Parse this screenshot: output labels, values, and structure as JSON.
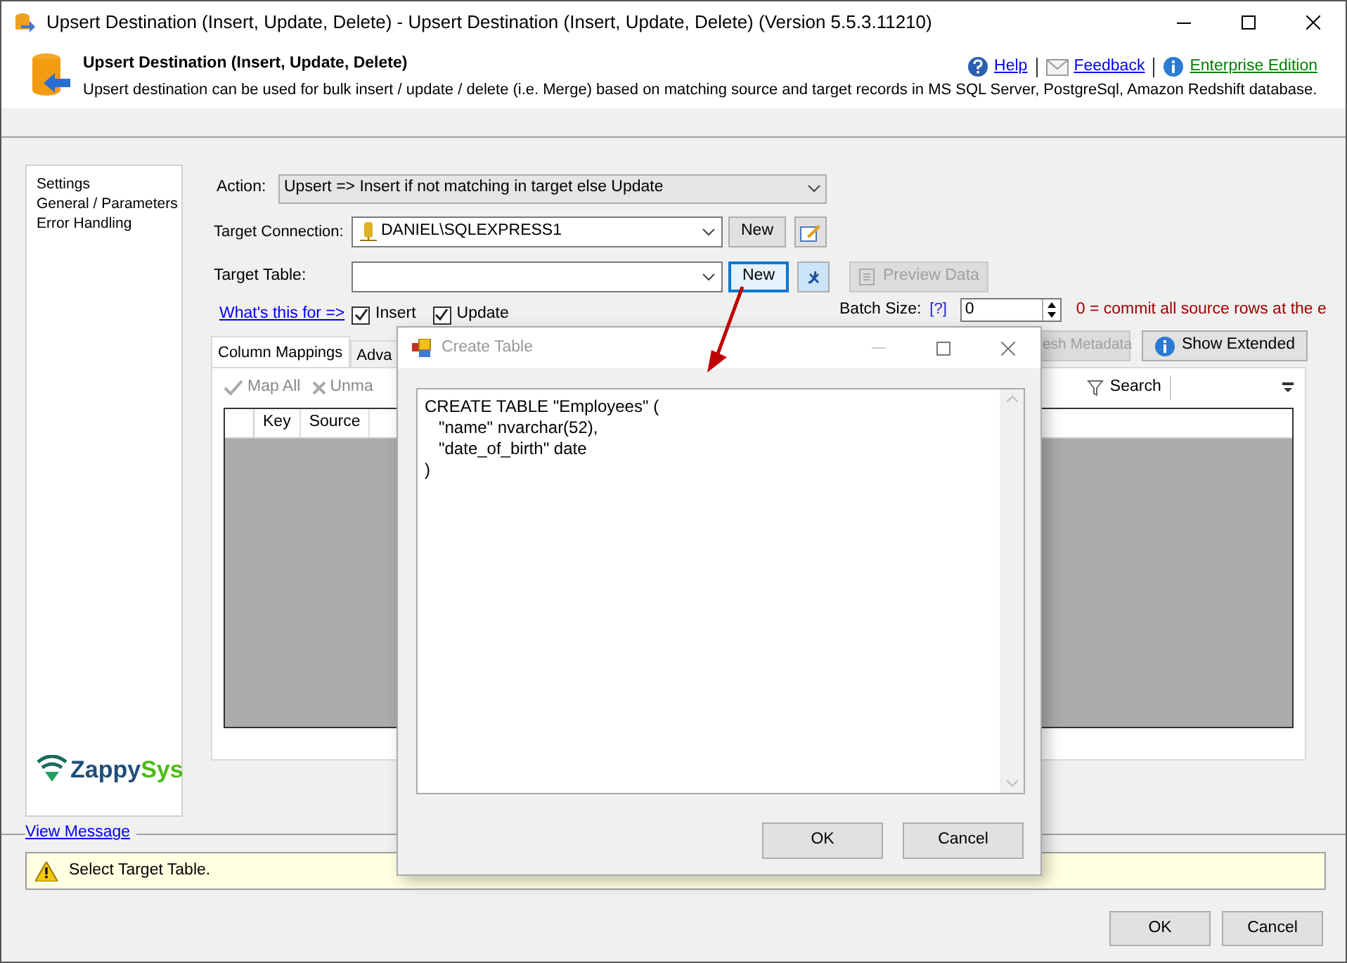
{
  "window": {
    "title": "Upsert Destination (Insert, Update, Delete) - Upsert Destination (Insert, Update, Delete) (Version 5.5.3.11210)"
  },
  "header": {
    "title": "Upsert Destination (Insert, Update, Delete)",
    "description": "Upsert destination can be used for bulk insert / update / delete (i.e. Merge) based on matching source and target records in MS SQL Server, PostgreSql, Amazon Redshift database.",
    "links": [
      {
        "label": "Help",
        "kind": "help"
      },
      {
        "label": "Feedback",
        "kind": "mail"
      },
      {
        "label": "Enterprise Edition",
        "kind": "info"
      }
    ]
  },
  "sidebar": {
    "items": [
      {
        "label": "Settings"
      },
      {
        "label": "General / Parameters"
      },
      {
        "label": "Error Handling"
      }
    ],
    "logo": [
      "Zappy",
      "Sys"
    ]
  },
  "form": {
    "action": {
      "label": "Action:",
      "value": "Upsert => Insert if not matching in target else Update"
    },
    "target_connection": {
      "label": "Target Connection:",
      "value": "DANIEL\\SQLEXPRESS1",
      "new_button": "New"
    },
    "target_table": {
      "label": "Target Table:",
      "new_button": "New",
      "preview_button": {
        "label": "Preview Data",
        "disabled": true
      }
    },
    "help_link": "What's this for =>",
    "options": [
      {
        "label": "Insert",
        "checked": true
      },
      {
        "label": "Update",
        "checked": true
      }
    ],
    "batch_size": {
      "label": "Batch Size:",
      "help": "[?]",
      "value": "0",
      "note": "0 = commit all source rows at the e"
    },
    "refresh_button": {
      "label": "esh Metadata",
      "disabled": true
    },
    "extended_button": "Show Extended"
  },
  "tabs": [
    {
      "label": "Column Mappings",
      "selected": true
    },
    {
      "label": "Adva",
      "selected": false
    }
  ],
  "toolbar": {
    "map_all": "Map All",
    "unmap": "Unma",
    "search": "Search"
  },
  "grid": {
    "columns": [
      "Key",
      "Source"
    ]
  },
  "message": {
    "title": "View Message",
    "text": "Select Target Table."
  },
  "buttons": [
    "OK",
    "Cancel"
  ],
  "dialog": {
    "title": "Create Table",
    "sql": "CREATE TABLE \"Employees\" (\n   \"name\" nvarchar(52),\n   \"date_of_birth\" date\n)",
    "buttons": [
      "OK",
      "Cancel"
    ]
  }
}
